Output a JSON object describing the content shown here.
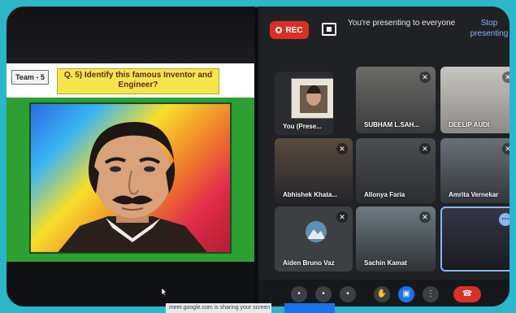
{
  "slide": {
    "team": "Team - 5",
    "question": "Q. 5) Identify this famous Inventor and Engineer?"
  },
  "meet": {
    "rec_label": "REC",
    "presenting_text": "You're presenting to everyone",
    "stop_label": "Stop presenting",
    "participants": [
      {
        "name": "You (Prese..."
      },
      {
        "name": "SUBHAM L.SAH..."
      },
      {
        "name": "DEELIP AUDI"
      },
      {
        "name": "Abhishek Khata..."
      },
      {
        "name": "Allonya Faria"
      },
      {
        "name": "Amrita Vernekar"
      },
      {
        "name": "Aiden Bruno Vaz"
      },
      {
        "name": "Sachin Kamat"
      },
      {
        "name": ""
      }
    ],
    "url_text": "meet.google.com is sharing your screen"
  },
  "icons": {
    "mic_off": "mic-off-icon",
    "present": "present-icon",
    "more": "more-options-icon"
  },
  "colors": {
    "rec": "#d93025",
    "accent": "#8ab4f8",
    "slide_green": "#2e9f33",
    "question_yellow": "#f7e54d"
  }
}
